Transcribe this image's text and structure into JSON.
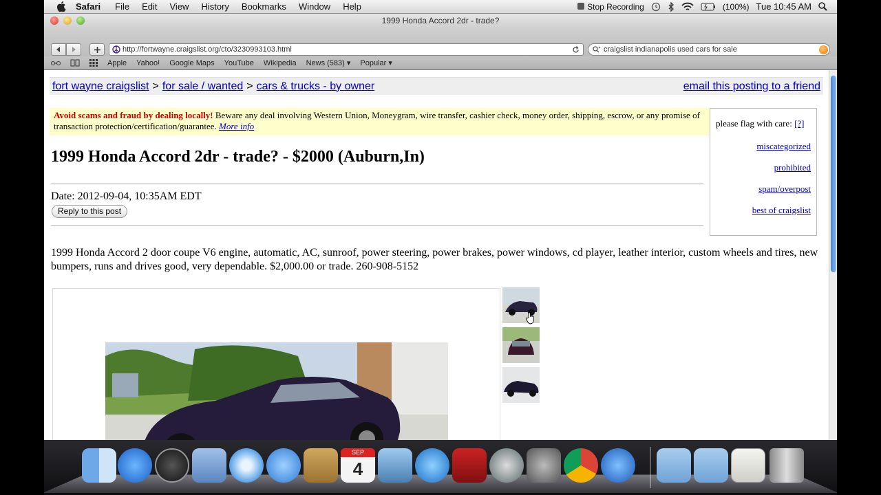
{
  "menubar": {
    "app_name": "Safari",
    "items": [
      "File",
      "Edit",
      "View",
      "History",
      "Bookmarks",
      "Window",
      "Help"
    ],
    "stop_recording": "Stop Recording",
    "battery": "(100%)",
    "clock": "Tue 10:45 AM"
  },
  "browser": {
    "window_title": "1999 Honda Accord 2dr - trade?",
    "url": "http://fortwayne.craigslist.org/cto/3230993103.html",
    "search_query": "craigslist indianapolis used cars for sale",
    "bookmarks": [
      "Apple",
      "Yahoo!",
      "Google Maps",
      "YouTube",
      "Wikipedia",
      "News (583) ▾",
      "Popular ▾"
    ]
  },
  "page": {
    "breadcrumbs": [
      "fort wayne craigslist",
      "for sale / wanted",
      "cars & trucks - by owner"
    ],
    "breadcrumb_sep": ">",
    "email_link": "email this posting to a friend",
    "warning_title": "Avoid scams and fraud by dealing locally!",
    "warning_text": " Beware any deal involving Western Union, Moneygram, wire transfer, cashier check, money order, shipping, escrow, or any promise of transaction protection/certification/guarantee. ",
    "warning_link": "More info",
    "flag_heading": "please flag with care:",
    "flag_help": "[?]",
    "flag_links": [
      "miscategorized",
      "prohibited",
      "spam/overpost",
      "best of craigslist"
    ],
    "title": "1999 Honda Accord 2dr - trade? - $2000 (Auburn,In)",
    "date": "Date: 2012-09-04, 10:35AM EDT",
    "reply_button": "Reply to this post",
    "body": "1999 Honda Accord 2 door coupe V6 engine, automatic, AC, sunroof, power steering, power brakes, power windows, cd player, leather interior, custom wheels and tires, new bumpers, runs and drives good, very dependable. $2,000.00 or trade. 260-908-5152"
  },
  "dock": {
    "apps": [
      "finder-icon",
      "app-store-icon",
      "dashboard-icon",
      "mail-icon",
      "safari-icon",
      "ichat-icon",
      "address-book-icon",
      "ical-icon",
      "iphoto-icon",
      "itunes-icon",
      "photo-booth-icon",
      "time-machine-icon",
      "system-preferences-icon",
      "chrome-icon",
      "quicktime-icon",
      "applications-folder-icon",
      "documents-folder-icon",
      "downloads-stack-icon",
      "trash-icon"
    ],
    "ical_day": "4",
    "ical_month": "SEP"
  }
}
